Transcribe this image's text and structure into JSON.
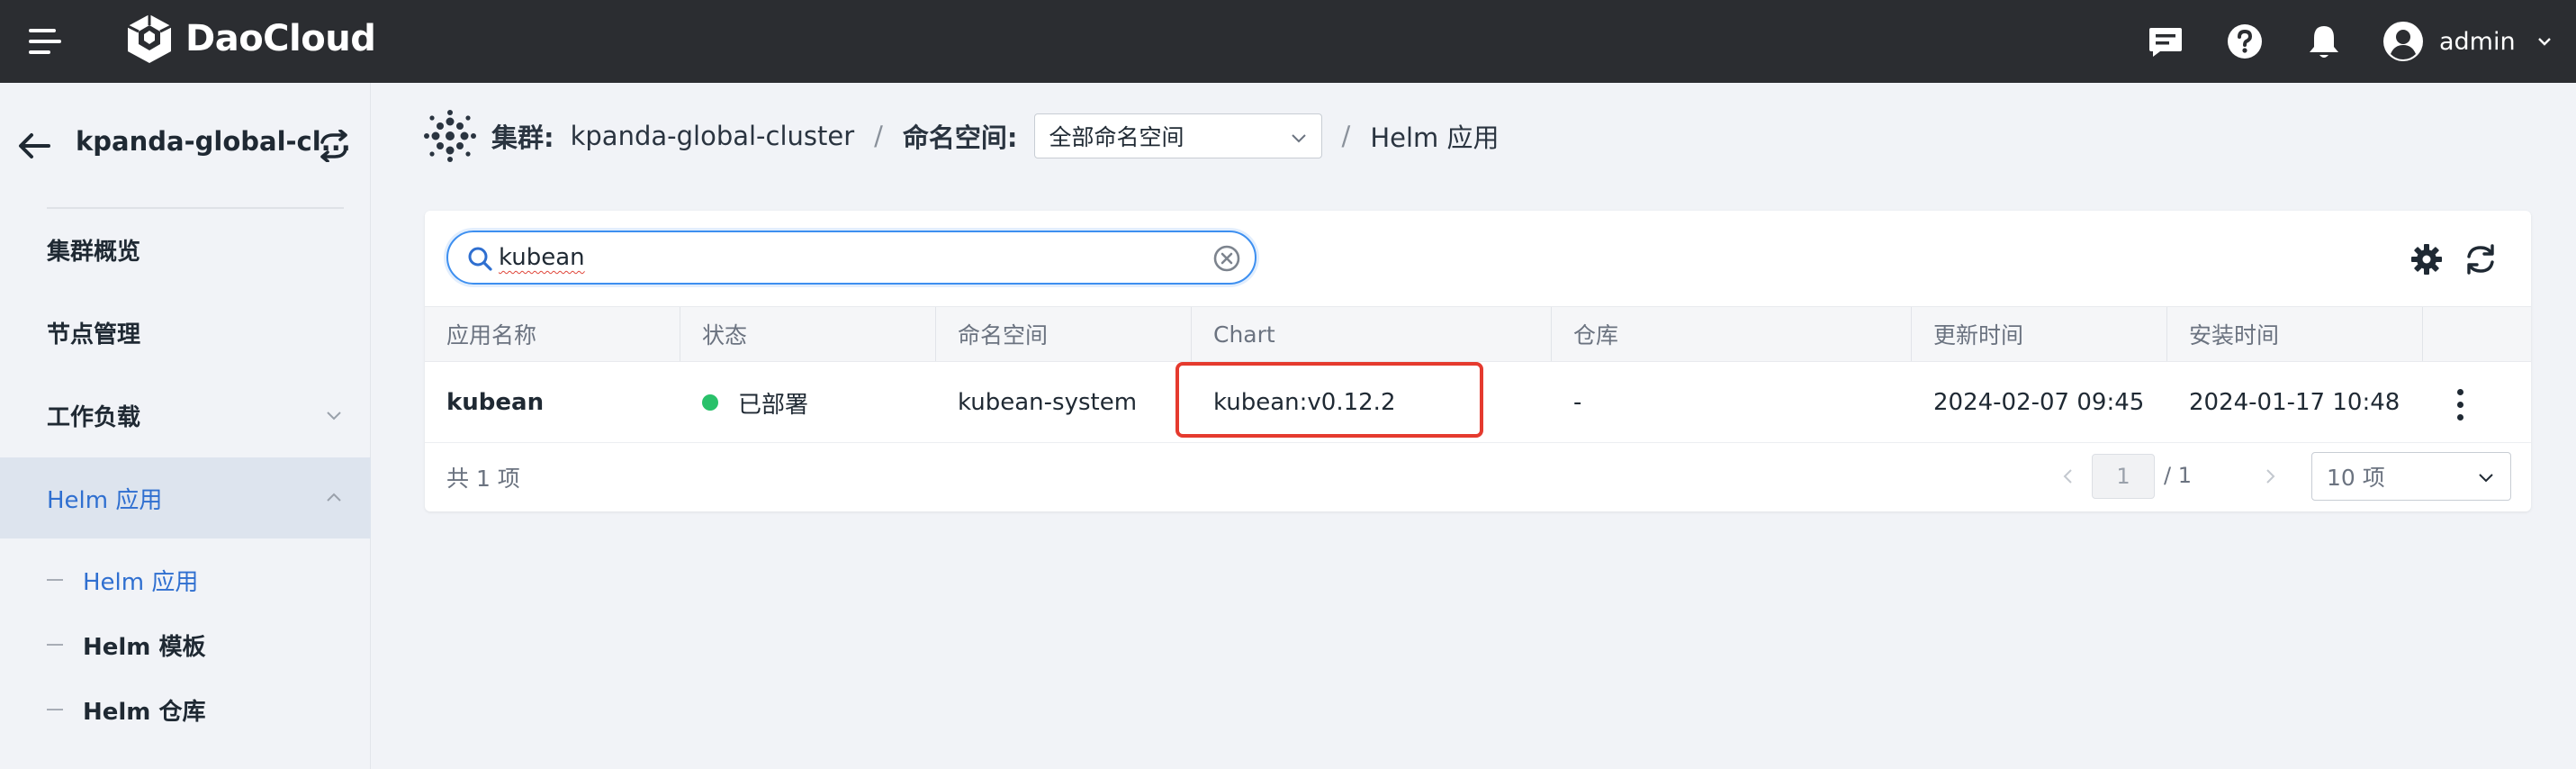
{
  "app": {
    "brand": "DaoCloud",
    "user": "admin"
  },
  "sidebar": {
    "cluster": "kpanda-global-cl...",
    "items": [
      {
        "label": "集群概览"
      },
      {
        "label": "节点管理"
      },
      {
        "label": "工作负载"
      },
      {
        "label": "Helm 应用"
      }
    ],
    "subitems": [
      {
        "label": "Helm 应用"
      },
      {
        "label": "Helm 模板"
      },
      {
        "label": "Helm 仓库"
      }
    ]
  },
  "breadcrumb": {
    "cluster_label": "集群:",
    "cluster_value": "kpanda-global-cluster",
    "ns_label": "命名空间:",
    "ns_value": "全部命名空间",
    "sep": "/",
    "page": "Helm 应用"
  },
  "search": {
    "value": "kubean"
  },
  "table": {
    "columns": [
      "应用名称",
      "状态",
      "命名空间",
      "Chart",
      "仓库",
      "更新时间",
      "安装时间"
    ],
    "rows": [
      {
        "name": "kubean",
        "status": "已部署",
        "namespace": "kubean-system",
        "chart": "kubean:v0.12.2",
        "repo": "-",
        "updated": "2024-02-07 09:45",
        "installed": "2024-01-17 10:48"
      }
    ]
  },
  "pagination": {
    "total": "共 1 项",
    "current": "1",
    "pages": "/ 1",
    "page_size": "10 项"
  },
  "colors": {
    "accent": "#2f6fd0",
    "status_ok": "#29c16a",
    "highlight": "#e53a2e",
    "topbar": "#2b2d31"
  }
}
